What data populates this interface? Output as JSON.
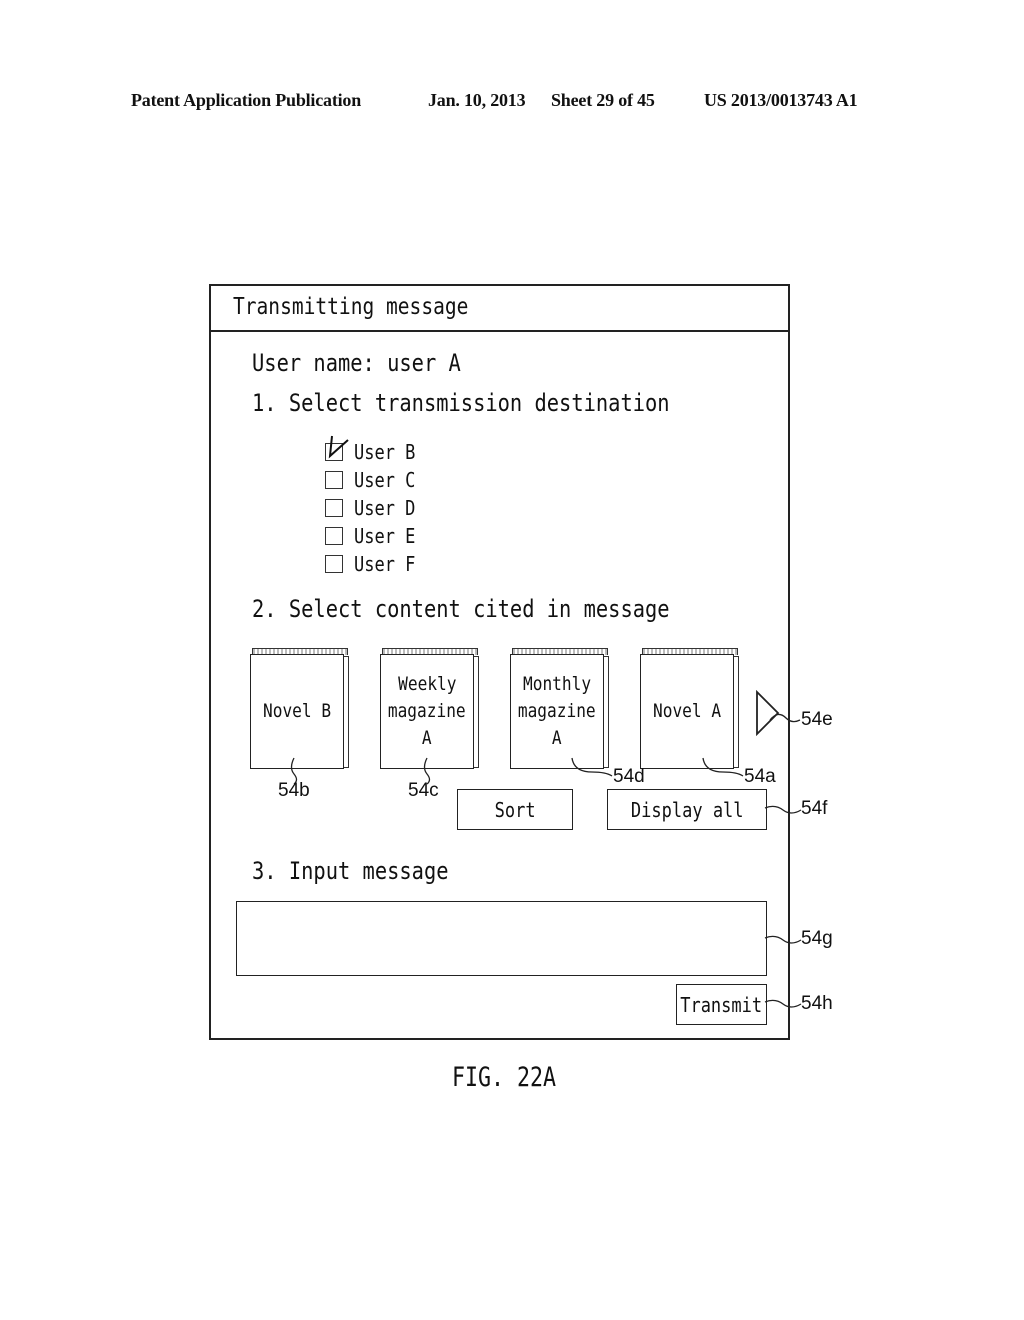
{
  "header": {
    "publication": "Patent Application Publication",
    "date": "Jan. 10, 2013",
    "sheet": "Sheet 29 of 45",
    "number": "US 2013/0013743 A1"
  },
  "screen": {
    "title": "Transmitting message",
    "user_name_line": "User name: user A",
    "step1": "1. Select transmission destination",
    "recipients": [
      {
        "label": "User B",
        "checked": true
      },
      {
        "label": "User C",
        "checked": false
      },
      {
        "label": "User D",
        "checked": false
      },
      {
        "label": "User E",
        "checked": false
      },
      {
        "label": "User F",
        "checked": false
      }
    ],
    "step2": "2. Select content cited in message",
    "contents": [
      {
        "lines": [
          "Novel B"
        ],
        "ref": "54b"
      },
      {
        "lines": [
          "Weekly",
          "magazine",
          "A"
        ],
        "ref": "54c"
      },
      {
        "lines": [
          "Monthly",
          "magazine",
          "A"
        ],
        "ref": "54d"
      },
      {
        "lines": [
          "Novel A"
        ],
        "ref": "54a"
      }
    ],
    "next_arrow_ref": "54e",
    "sort_button": "Sort",
    "display_all_button": "Display all",
    "display_all_ref": "54f",
    "step3": "3. Input message",
    "message_input_value": "",
    "message_input_ref": "54g",
    "transmit_button": "Transmit",
    "transmit_ref": "54h"
  },
  "figure_caption": "FIG. 22A"
}
